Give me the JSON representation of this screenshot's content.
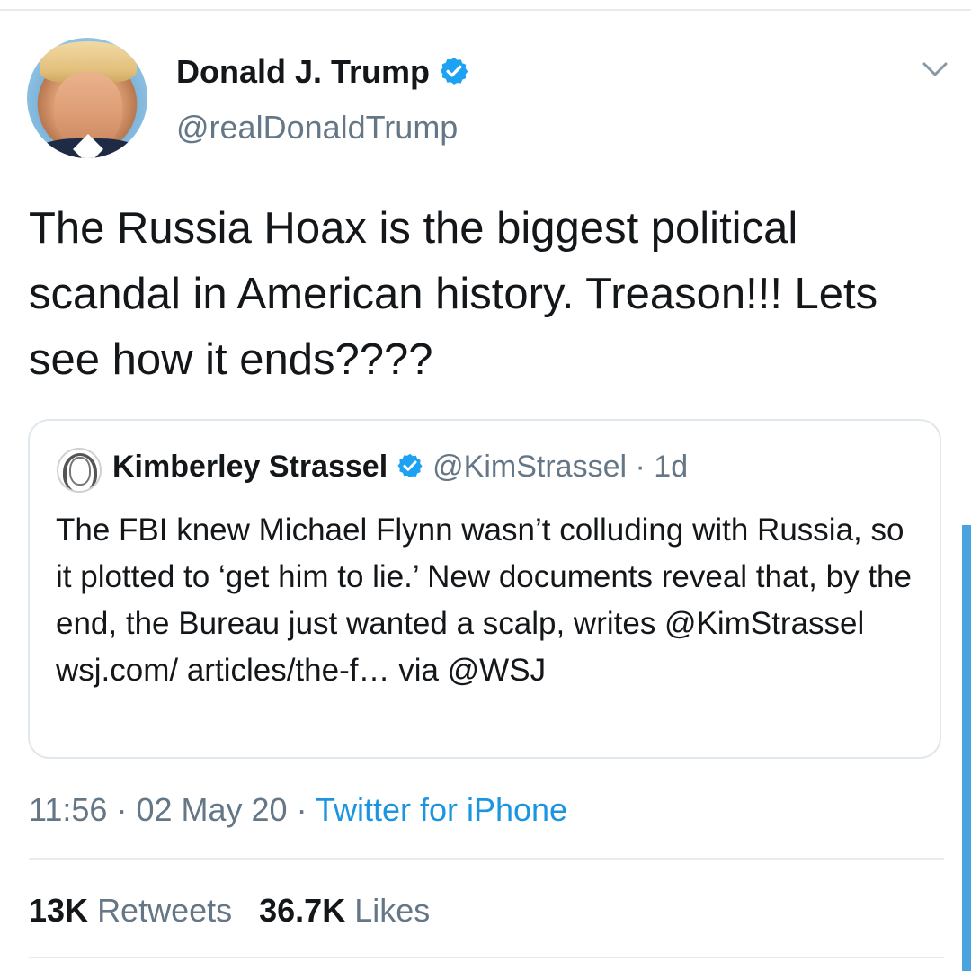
{
  "author": {
    "display_name": "Donald J. Trump",
    "handle": "@realDonaldTrump",
    "verified_icon": "verified-badge-icon"
  },
  "tweet": {
    "text": "The Russia Hoax is the biggest political scandal in American history. Treason!!! Lets see how it ends????"
  },
  "quoted_tweet": {
    "display_name": "Kimberley Strassel",
    "handle": "@KimStrassel",
    "separator": "·",
    "age": "1d",
    "text": "The FBI knew Michael Flynn wasn’t colluding with Russia, so it plotted to ‘get him to lie.’ New documents reveal that, by the end, the Bureau just wanted a scalp, writes @KimStrassel wsj.com/ articles/the-f… via @WSJ"
  },
  "meta": {
    "time": "11:56",
    "date": "02 May 20",
    "separator": "·",
    "source": "Twitter for iPhone"
  },
  "stats": {
    "retweets_count": "13K",
    "retweets_label": "Retweets",
    "likes_count": "36.7K",
    "likes_label": "Likes"
  },
  "colors": {
    "accent": "#1b95e0",
    "verified": "#1da1f2",
    "secondary_text": "#657786",
    "primary_text": "#14171a",
    "border": "#e1e8ed"
  }
}
